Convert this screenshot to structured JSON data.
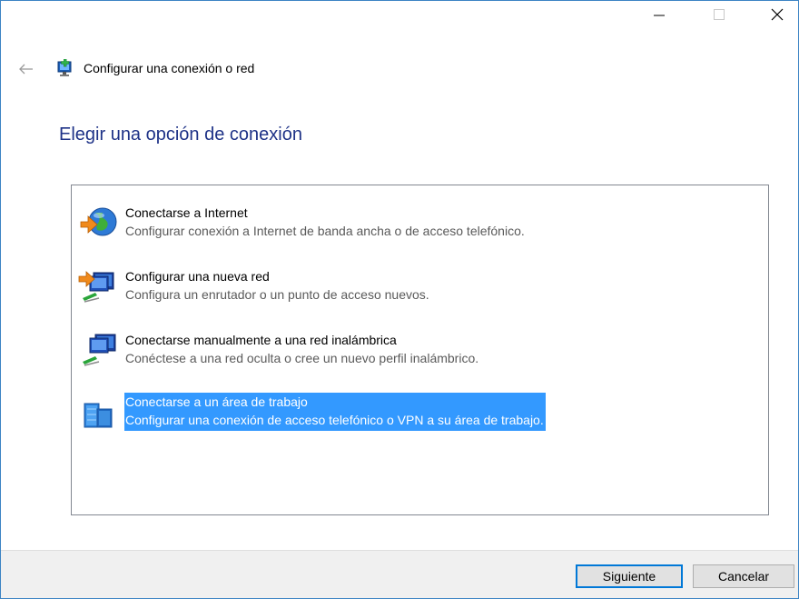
{
  "window": {
    "title": "Configurar una conexión o red"
  },
  "page": {
    "heading": "Elegir una opción de conexión"
  },
  "options": [
    {
      "title": "Conectarse a Internet",
      "description": "Configurar conexión a Internet de banda ancha o de acceso telefónico.",
      "icon": "globe-internet-icon",
      "selected": false
    },
    {
      "title": "Configurar una nueva red",
      "description": "Configura un enrutador o un punto de acceso nuevos.",
      "icon": "new-network-icon",
      "selected": false
    },
    {
      "title": "Conectarse manualmente a una red inalámbrica",
      "description": "Conéctese a una red oculta o cree un nuevo perfil inalámbrico.",
      "icon": "wireless-network-icon",
      "selected": false
    },
    {
      "title": "Conectarse a un área de trabajo",
      "description": "Configurar una conexión de acceso telefónico o VPN a su área de trabajo.",
      "icon": "workplace-vpn-icon",
      "selected": true
    }
  ],
  "buttons": {
    "next": "Siguiente",
    "cancel": "Cancelar"
  },
  "colors": {
    "heading": "#1e3287",
    "selection": "#3399ff",
    "window_border": "#3c84c4",
    "default_button_border": "#0078d7"
  }
}
